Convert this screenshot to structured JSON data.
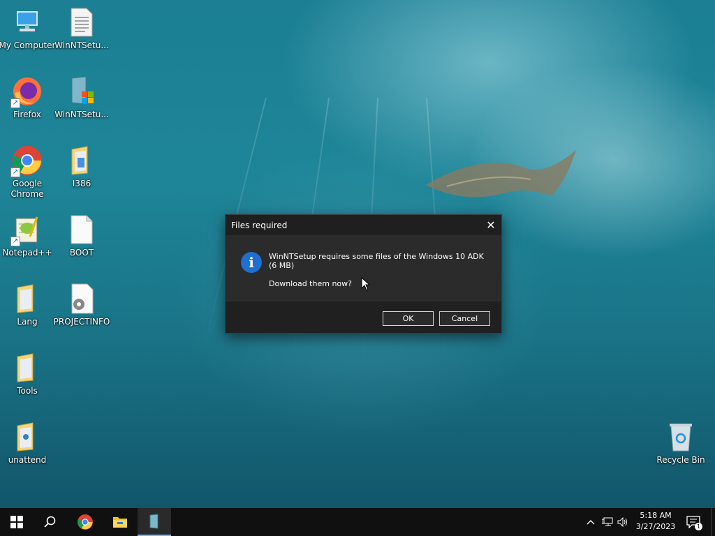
{
  "desktop": {
    "icons": [
      {
        "label": "My Computer",
        "icon": "computer-icon"
      },
      {
        "label": "WinNTSetu...",
        "icon": "text-document-icon"
      },
      {
        "label": "Firefox",
        "icon": "firefox-icon"
      },
      {
        "label": "WinNTSetu...",
        "icon": "winntsetup-app-icon"
      },
      {
        "label": "Google\nChrome",
        "icon": "chrome-icon"
      },
      {
        "label": "I386",
        "icon": "folder-icon"
      },
      {
        "label": "Notepad++",
        "icon": "notepadpp-icon"
      },
      {
        "label": "BOOT",
        "icon": "blank-file-icon"
      },
      {
        "label": "Lang",
        "icon": "folder-icon"
      },
      {
        "label": "PROJECTINFO",
        "icon": "settings-file-icon"
      },
      {
        "label": "Tools",
        "icon": "folder-icon"
      },
      {
        "label": "unattend",
        "icon": "folder-icon"
      },
      {
        "label": "Recycle Bin",
        "icon": "recycle-bin-icon"
      }
    ]
  },
  "dialog": {
    "title": "Files required",
    "message": "WinNTSetup requires some files of the Windows 10 ADK (6 MB)",
    "question": "Download them now?",
    "ok_label": "OK",
    "cancel_label": "Cancel",
    "icon": "info-icon"
  },
  "taskbar": {
    "time": "5:18 AM",
    "date": "3/27/2023",
    "notification_count": "1",
    "accent": "#7fb3e6"
  }
}
